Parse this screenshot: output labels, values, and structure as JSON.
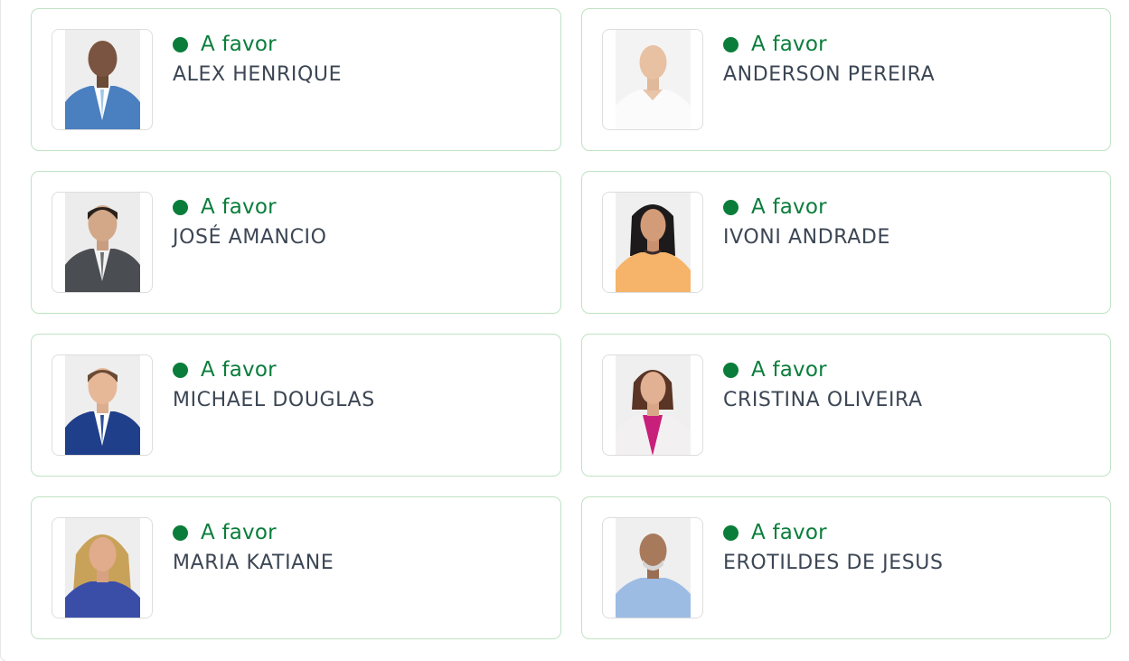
{
  "accent_color": "#0a7d3b",
  "card_border_color": "#bfe3c4",
  "vote_icon": "green-dot-icon",
  "voters": [
    {
      "vote": "A favor",
      "name": "ALEX HENRIQUE"
    },
    {
      "vote": "A favor",
      "name": "ANDERSON PEREIRA"
    },
    {
      "vote": "A favor",
      "name": "JOSÉ AMANCIO"
    },
    {
      "vote": "A favor",
      "name": "IVONI ANDRADE"
    },
    {
      "vote": "A favor",
      "name": "MICHAEL DOUGLAS"
    },
    {
      "vote": "A favor",
      "name": "CRISTINA OLIVEIRA"
    },
    {
      "vote": "A favor",
      "name": "MARIA KATIANE"
    },
    {
      "vote": "A favor",
      "name": "EROTILDES DE JESUS"
    }
  ]
}
